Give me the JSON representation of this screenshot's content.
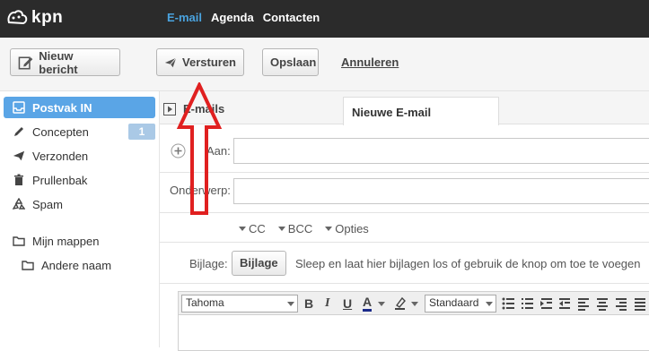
{
  "brand": {
    "logo_text": "kpn"
  },
  "topnav": {
    "email": "E-mail",
    "agenda": "Agenda",
    "contacten": "Contacten"
  },
  "toolbar": {
    "new_message": "Nieuw bericht",
    "send": "Versturen",
    "save": "Opslaan",
    "cancel": "Annuleren"
  },
  "sidebar": {
    "items": [
      {
        "label": "Postvak IN",
        "icon": "inbox-icon",
        "active": true
      },
      {
        "label": "Concepten",
        "icon": "pencil-icon",
        "badge": "1"
      },
      {
        "label": "Verzonden",
        "icon": "paper-plane-icon"
      },
      {
        "label": "Prullenbak",
        "icon": "trash-icon"
      },
      {
        "label": "Spam",
        "icon": "recycle-icon"
      },
      {
        "label": "Mijn mappen",
        "icon": "folder-icon"
      },
      {
        "label": "Andere naam",
        "icon": "folder-icon"
      }
    ]
  },
  "tabs": {
    "emails": "E-mails",
    "new_email": "Nieuwe E-mail"
  },
  "compose": {
    "to_label": "Aan:",
    "subject_label": "Onderwerp:",
    "cc": "CC",
    "bcc": "BCC",
    "options": "Opties",
    "attachment_label": "Bijlage:",
    "attachment_button": "Bijlage",
    "attachment_hint": "Sleep en laat hier bijlagen los of gebruik de knop om toe te voegen"
  },
  "editor": {
    "font": "Tahoma",
    "size": "Standaard"
  },
  "colors": {
    "topbar": "#2b2b2b",
    "accent": "#4aa3df",
    "active_item": "#5aa5e6",
    "annotation_arrow": "#e02020"
  }
}
